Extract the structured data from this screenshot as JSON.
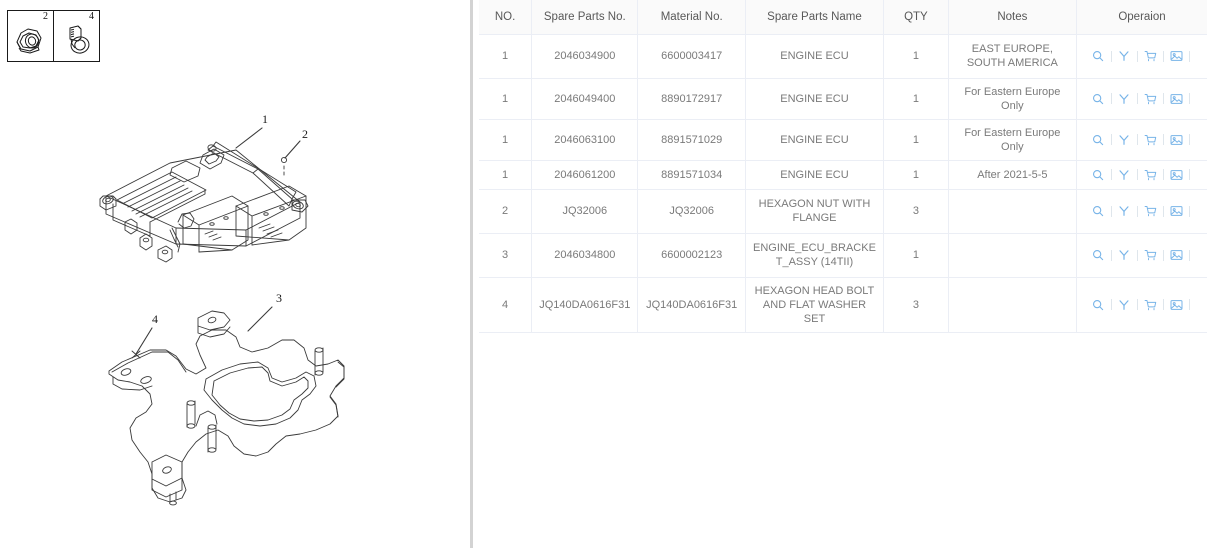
{
  "diagram": {
    "thumbnails": [
      {
        "number": "2",
        "icon": "hex-flange-nut-icon"
      },
      {
        "number": "4",
        "icon": "hex-head-bolt-washer-icon"
      }
    ],
    "main_callouts": [
      {
        "label": "1",
        "target": "engine-ecu"
      },
      {
        "label": "2",
        "target": "hexagon-nut-with-flange"
      },
      {
        "label": "3",
        "target": "engine-ecu-bracket-assy"
      },
      {
        "label": "4",
        "target": "hexagon-head-bolt-and-flat-washer-set"
      }
    ],
    "parts_illustration_name": "engine-ecu-exploded-diagram",
    "bracket_illustration_name": "engine-ecu-bracket-diagram"
  },
  "table": {
    "columns": [
      "NO.",
      "Spare Parts No.",
      "Material No.",
      "Spare Parts Name",
      "QTY",
      "Notes",
      "Operaion"
    ],
    "operation_icons": [
      "search-icon",
      "filter-icon",
      "cart-icon",
      "image-icon"
    ],
    "rows": [
      {
        "no": "1",
        "spare_parts_no": "2046034900",
        "material_no": "6600003417",
        "spare_parts_name": "ENGINE ECU",
        "qty": "1",
        "notes": "EAST EUROPE, SOUTH AMERICA"
      },
      {
        "no": "1",
        "spare_parts_no": "2046049400",
        "material_no": "8890172917",
        "spare_parts_name": "ENGINE ECU",
        "qty": "1",
        "notes": "For Eastern Europe Only"
      },
      {
        "no": "1",
        "spare_parts_no": "2046063100",
        "material_no": "8891571029",
        "spare_parts_name": "ENGINE ECU",
        "qty": "1",
        "notes": "For Eastern Europe Only"
      },
      {
        "no": "1",
        "spare_parts_no": "2046061200",
        "material_no": "8891571034",
        "spare_parts_name": "ENGINE ECU",
        "qty": "1",
        "notes": "After 2021-5-5"
      },
      {
        "no": "2",
        "spare_parts_no": "JQ32006",
        "material_no": "JQ32006",
        "spare_parts_name": "HEXAGON NUT WITH FLANGE",
        "qty": "3",
        "notes": ""
      },
      {
        "no": "3",
        "spare_parts_no": "2046034800",
        "material_no": "6600002123",
        "spare_parts_name": "ENGINE_ECU_BRACKET_ASSY (14TII)",
        "qty": "1",
        "notes": ""
      },
      {
        "no": "4",
        "spare_parts_no": "JQ140DA0616F31",
        "material_no": "JQ140DA0616F31",
        "spare_parts_name": "HEXAGON HEAD BOLT AND FLAT WASHER SET",
        "qty": "3",
        "notes": ""
      }
    ]
  },
  "colors": {
    "icon_blue": "#78b4e8",
    "header_bg": "#fafafa",
    "border": "#ebeef5",
    "text": "#7a7a7a",
    "divider": "#d3d3d3"
  }
}
